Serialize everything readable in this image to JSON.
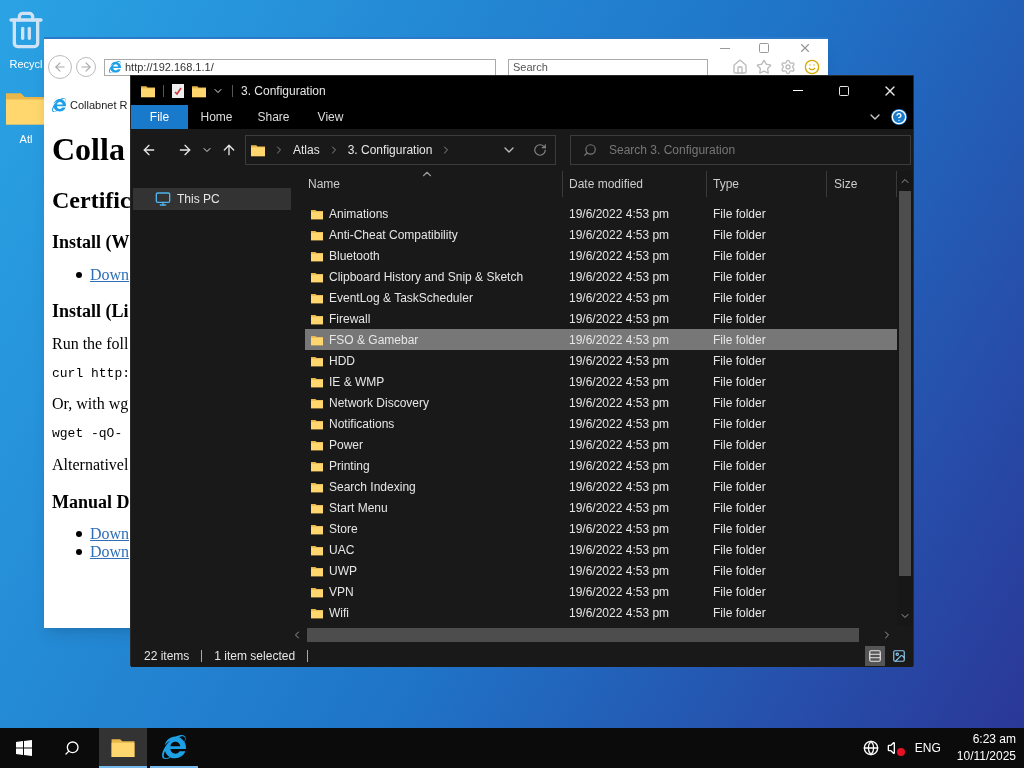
{
  "desktop": {
    "icons": [
      {
        "kind": "recycle-bin",
        "label": "Recycl"
      },
      {
        "kind": "folder",
        "label": "Atl"
      }
    ]
  },
  "browser": {
    "address": "http://192.168.1.1/",
    "search_placeholder": "Search",
    "tab": "Collabnet R",
    "content": [
      {
        "kind": "h1",
        "text": "Colla"
      },
      {
        "kind": "h2",
        "text": "Certific"
      },
      {
        "kind": "h3",
        "text": "Install (W"
      },
      {
        "kind": "link",
        "text": "Down"
      },
      {
        "kind": "h3",
        "text": "Install (Li"
      },
      {
        "kind": "p",
        "text": "Run the foll"
      },
      {
        "kind": "code",
        "text": "curl http:"
      },
      {
        "kind": "p",
        "text": "Or, with wg"
      },
      {
        "kind": "code",
        "text": "wget -qO-"
      },
      {
        "kind": "p",
        "text": "Alternativel"
      },
      {
        "kind": "h3",
        "text": "Manual D"
      },
      {
        "kind": "link",
        "text": "Down"
      },
      {
        "kind": "link",
        "text": "Down"
      }
    ]
  },
  "explorer": {
    "title": "3. Configuration",
    "ribbon_tabs": [
      {
        "label": "File",
        "selected": true
      },
      {
        "label": "Home",
        "selected": false
      },
      {
        "label": "Share",
        "selected": false
      },
      {
        "label": "View",
        "selected": false
      }
    ],
    "breadcrumb": [
      "Atlas",
      "3. Configuration"
    ],
    "search_placeholder": "Search 3. Configuration",
    "nav_pane": [
      {
        "label": "This PC",
        "selected": true
      }
    ],
    "columns": [
      {
        "label": "Name",
        "sorted": true
      },
      {
        "label": "Date modified",
        "sorted": false
      },
      {
        "label": "Type",
        "sorted": false
      },
      {
        "label": "Size",
        "sorted": false
      }
    ],
    "rows": [
      {
        "name": "Animations",
        "date": "19/6/2022 4:53 pm",
        "type": "File folder",
        "selected": false
      },
      {
        "name": "Anti-Cheat Compatibility",
        "date": "19/6/2022 4:53 pm",
        "type": "File folder",
        "selected": false
      },
      {
        "name": "Bluetooth",
        "date": "19/6/2022 4:53 pm",
        "type": "File folder",
        "selected": false
      },
      {
        "name": "Clipboard History and Snip & Sketch",
        "date": "19/6/2022 4:53 pm",
        "type": "File folder",
        "selected": false
      },
      {
        "name": "EventLog & TaskScheduler",
        "date": "19/6/2022 4:53 pm",
        "type": "File folder",
        "selected": false
      },
      {
        "name": "Firewall",
        "date": "19/6/2022 4:53 pm",
        "type": "File folder",
        "selected": false
      },
      {
        "name": "FSO & Gamebar",
        "date": "19/6/2022 4:53 pm",
        "type": "File folder",
        "selected": true
      },
      {
        "name": "HDD",
        "date": "19/6/2022 4:53 pm",
        "type": "File folder",
        "selected": false
      },
      {
        "name": "IE & WMP",
        "date": "19/6/2022 4:53 pm",
        "type": "File folder",
        "selected": false
      },
      {
        "name": "Network Discovery",
        "date": "19/6/2022 4:53 pm",
        "type": "File folder",
        "selected": false
      },
      {
        "name": "Notifications",
        "date": "19/6/2022 4:53 pm",
        "type": "File folder",
        "selected": false
      },
      {
        "name": "Power",
        "date": "19/6/2022 4:53 pm",
        "type": "File folder",
        "selected": false
      },
      {
        "name": "Printing",
        "date": "19/6/2022 4:53 pm",
        "type": "File folder",
        "selected": false
      },
      {
        "name": "Search Indexing",
        "date": "19/6/2022 4:53 pm",
        "type": "File folder",
        "selected": false
      },
      {
        "name": "Start Menu",
        "date": "19/6/2022 4:53 pm",
        "type": "File folder",
        "selected": false
      },
      {
        "name": "Store",
        "date": "19/6/2022 4:53 pm",
        "type": "File folder",
        "selected": false
      },
      {
        "name": "UAC",
        "date": "19/6/2022 4:53 pm",
        "type": "File folder",
        "selected": false
      },
      {
        "name": "UWP",
        "date": "19/6/2022 4:53 pm",
        "type": "File folder",
        "selected": false
      },
      {
        "name": "VPN",
        "date": "19/6/2022 4:53 pm",
        "type": "File folder",
        "selected": false
      },
      {
        "name": "Wifi",
        "date": "19/6/2022 4:53 pm",
        "type": "File folder",
        "selected": false
      }
    ],
    "status": {
      "item_count": "22 items",
      "selection": "1 item selected"
    },
    "view_buttons": [
      {
        "kind": "details",
        "selected": true
      },
      {
        "kind": "large-icons",
        "selected": false
      }
    ]
  },
  "taskbar": {
    "apps": [
      {
        "kind": "file-explorer",
        "selected": true
      },
      {
        "kind": "web-browser",
        "selected": false
      }
    ],
    "muted": true,
    "language": "ENG",
    "time": "6:23 am",
    "date": "10/11/2025"
  }
}
